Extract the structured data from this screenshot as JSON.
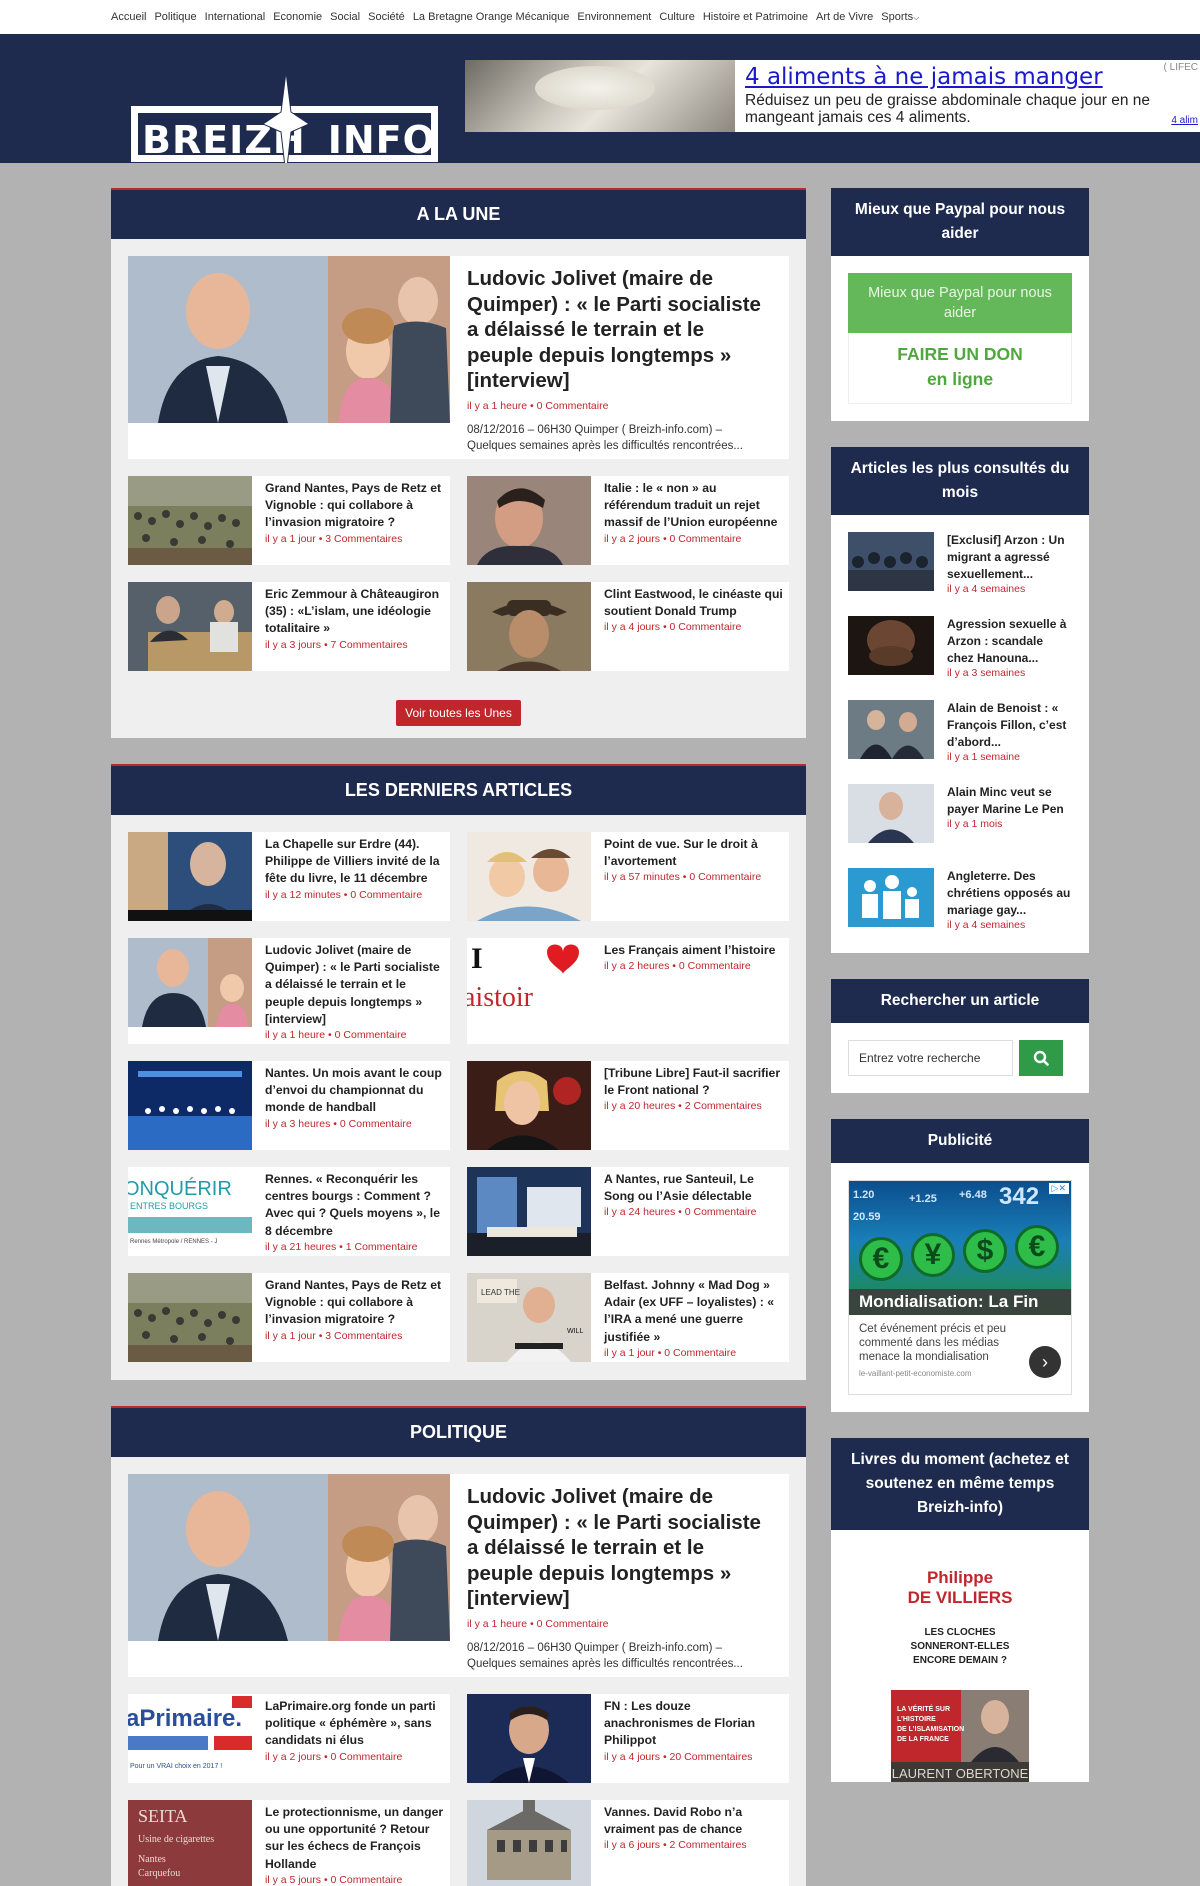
{
  "nav": [
    "Accueil",
    "Politique",
    "International",
    "Economie",
    "Social",
    "Société",
    "La Bretagne Orange Mécanique",
    "Environnement",
    "Culture",
    "Histoire et Patrimoine",
    "Art de Vivre",
    "Sports"
  ],
  "logo": {
    "left": "BREIZH",
    "right": "INFO"
  },
  "banner": {
    "title": "4 aliments à ne jamais manger",
    "subtitle": "Réduisez un peu de graisse abdominale chaque jour en ne mangeant jamais ces 4 aliments.",
    "corner": "( LIFEC",
    "link": "4 alim"
  },
  "une": {
    "heading": "A LA UNE",
    "feature": {
      "title": "Ludovic Jolivet (maire de Quimper) : « le Parti socialiste a délaissé le terrain et le peuple depuis longtemps » [interview]",
      "time": "il y a 1 heure",
      "comments": "0 Commentaire",
      "excerpt": "08/12/2016 – 06H30 Quimper ( Breizh-info.com) – Quelques semaines après les difficultés rencontrées..."
    },
    "cards": [
      {
        "title": "Grand Nantes, Pays de Retz et Vignoble : qui collabore à l’invasion migratoire ?",
        "time": "il y a 1 jour",
        "comments": "3 Commentaires"
      },
      {
        "title": "Italie : le « non » au référendum traduit un rejet massif de l’Union européenne",
        "time": "il y a 2 jours",
        "comments": "0 Commentaire"
      },
      {
        "title": "Eric Zemmour à Châteaugiron (35) : «L’islam, une idéologie totalitaire »",
        "time": "il y a 3 jours",
        "comments": "7 Commentaires"
      },
      {
        "title": "Clint Eastwood, le cinéaste qui soutient Donald Trump",
        "time": "il y a 4 jours",
        "comments": "0 Commentaire"
      }
    ],
    "button": "Voir toutes les Unes"
  },
  "derniers": {
    "heading": "LES DERNIERS ARTICLES",
    "cards": [
      {
        "title": "La Chapelle sur Erdre (44). Philippe de Villiers invité de la fête du livre, le 11 décembre",
        "time": "il y a 12 minutes",
        "comments": "0 Commentaire"
      },
      {
        "title": "Point de vue. Sur le droit à l’avortement",
        "time": "il y a 57 minutes",
        "comments": "0 Commentaire"
      },
      {
        "title": "Ludovic Jolivet (maire de Quimper) : « le Parti socialiste a délaissé le terrain et le peuple depuis longtemps » [interview]",
        "time": "il y a 1 heure",
        "comments": "0 Commentaire"
      },
      {
        "title": "Les Français aiment l’histoire",
        "time": "il y a 2 heures",
        "comments": "0 Commentaire"
      },
      {
        "title": "Nantes. Un mois avant le coup d’envoi du championnat du monde de handball",
        "time": "il y a 3 heures",
        "comments": "0 Commentaire"
      },
      {
        "title": "[Tribune Libre] Faut-il sacrifier le Front national ?",
        "time": "il y a 20 heures",
        "comments": "2 Commentaires"
      },
      {
        "title": "Rennes. « Reconquérir les centres bourgs : Comment ? Avec qui ? Quels moyens », le 8 décembre",
        "time": "il y a 21 heures",
        "comments": "1 Commentaire"
      },
      {
        "title": "A Nantes, rue Santeuil, Le Song ou l’Asie délectable",
        "time": "il y a 24 heures",
        "comments": "0 Commentaire"
      },
      {
        "title": "Grand Nantes, Pays de Retz et Vignoble : qui collabore à l’invasion migratoire ?",
        "time": "il y a 1 jour",
        "comments": "3 Commentaires"
      },
      {
        "title": "Belfast. Johnny « Mad Dog » Adair (ex UFF – loyalistes) : « l’IRA a mené une guerre justifiée »",
        "time": "il y a 1 jour",
        "comments": "0 Commentaire"
      }
    ]
  },
  "politique": {
    "heading": "POLITIQUE",
    "feature": {
      "title": "Ludovic Jolivet (maire de Quimper) : « le Parti socialiste a délaissé le terrain et le peuple depuis longtemps » [interview]",
      "time": "il y a 1 heure",
      "comments": "0 Commentaire",
      "excerpt": "08/12/2016 – 06H30 Quimper ( Breizh-info.com) – Quelques semaines après les difficultés rencontrées..."
    },
    "cards": [
      {
        "title": "LaPrimaire.org fonde un parti politique « éphémère », sans candidats ni élus",
        "time": "il y a 2 jours",
        "comments": "0 Commentaire"
      },
      {
        "title": "FN : Les douze anachronismes de Florian Philippot",
        "time": "il y a 4 jours",
        "comments": "20 Commentaires"
      },
      {
        "title": "Le protectionnisme, un danger ou une opportunité ? Retour sur les échecs de François Hollande",
        "time": "il y a 5 jours",
        "comments": "0 Commentaire"
      },
      {
        "title": "Vannes. David Robo n’a vraiment pas de chance",
        "time": "il y a 6 jours",
        "comments": "2 Commentaires"
      }
    ]
  },
  "sidebar": {
    "paypal": {
      "heading": "Mieux que Paypal pour nous aider",
      "top": "Mieux que Paypal pour nous aider",
      "bottom1": "FAIRE UN DON",
      "bottom2": "en ligne"
    },
    "popular": {
      "heading": "Articles les plus consultés du mois",
      "items": [
        {
          "title": "[Exclusif] Arzon : Un migrant a agressé sexuellement...",
          "time": "il y a 4 semaines"
        },
        {
          "title": "Agression sexuelle à Arzon : scandale chez Hanouna...",
          "time": "il y a 3 semaines"
        },
        {
          "title": "Alain de Benoist : « François Fillon, c’est d’abord...",
          "time": "il y a 1 semaine"
        },
        {
          "title": "Alain Minc veut se payer Marine Le Pen",
          "time": "il y a 1 mois"
        },
        {
          "title": "Angleterre. Des chrétiens opposés au mariage gay...",
          "time": "il y a 4 semaines"
        }
      ]
    },
    "search": {
      "heading": "Rechercher un article",
      "placeholder": "Entrez votre recherche"
    },
    "pub": {
      "heading": "Publicité",
      "ad_title": "Mondialisation: La Fin",
      "ad_text": "Cet événement précis et peu commenté dans les médias menace la mondialisation",
      "ad_url": "le-vaillant-petit-economiste.com",
      "numbers": [
        "20.59",
        "+1.25",
        "+6.48",
        "342",
        "1.20"
      ]
    },
    "livres": {
      "heading": "Livres du moment (achetez et soutenez en même temps Breizh-info)",
      "book1_author1": "Philippe",
      "book1_author2": "DE VILLIERS",
      "book1_title": "LES CLOCHES SONNERONT-ELLES ENCORE DEMAIN ?",
      "book1_band": "LA VÉRITÉ SUR L’HISTOIRE DE L’ISLAMISATION DE LA FRANCE",
      "book2_author": "LAURENT OBERTONE"
    }
  },
  "colors": {
    "navy": "#1e2b4f",
    "red": "#c0272d",
    "green": "#2f9b49"
  }
}
